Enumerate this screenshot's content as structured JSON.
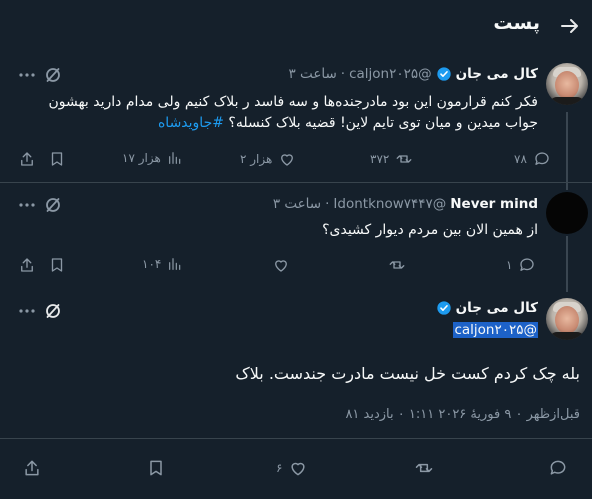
{
  "header": {
    "title": "پست"
  },
  "reply1": {
    "name": "کال می جان",
    "handle": "@caljon۲۰۲۵",
    "sep": "·",
    "time": "ساعت ۳",
    "text_a": "فکر کنم قرارمون این بود مادرجنده‌ها و سه فاسد ر بلاک کنیم ولی مدام دارید بهشون جواب میدین و میان توی تایم لاین! قضیه بلاک کنسله؟",
    "hashtag": "#جاویدشاه",
    "replies": "۷۸",
    "reposts": "۳۷۲",
    "likes": "۲ هزار",
    "views": "۱۷ هزار"
  },
  "reply2": {
    "name": "Never mind",
    "handle": "@Idontknow۷۴۴۷",
    "sep": "·",
    "time": "ساعت ۳",
    "text": "از همین الان بین مردم دیوار کشیدی؟",
    "replies": "۱",
    "views": "۱۰۴"
  },
  "main": {
    "name": "کال می جان",
    "handle": "@caljon۲۰۲۵",
    "text": "بله چک کردم کست خل نیست مادرت جندست. بلاک",
    "meta": "قبل‌ازظهر ۰ ۹ فوریهٔ ۲۰۲۶ ۱:۱۱ ۰ بازدید ۸۱",
    "likes": "۶"
  }
}
